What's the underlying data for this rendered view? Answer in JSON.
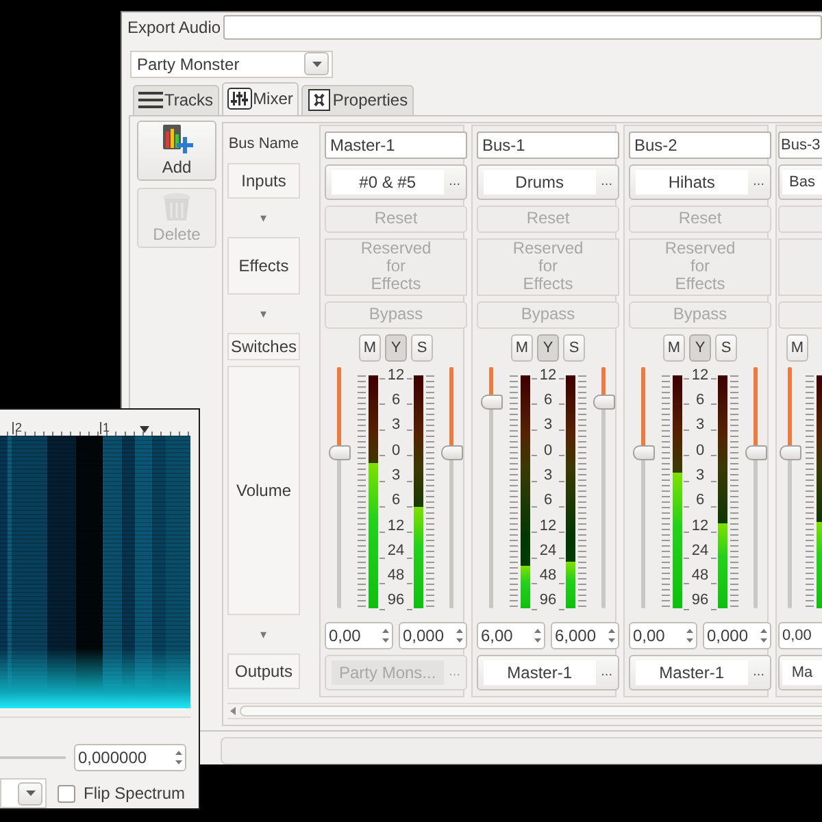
{
  "export_window": {
    "title_label": "Export Audio",
    "project_dropdown": "Party Monster",
    "tabs": [
      {
        "label": "Tracks",
        "selected": false
      },
      {
        "label": "Mixer",
        "selected": true
      },
      {
        "label": "Properties",
        "selected": false
      }
    ],
    "tools": [
      {
        "label": "Add",
        "disabled": false
      },
      {
        "label": "Delete",
        "disabled": true
      }
    ],
    "mixer": {
      "row_labels": [
        {
          "kind": "plain",
          "text": "Bus Name"
        },
        {
          "kind": "boxed",
          "text": "Inputs"
        },
        {
          "kind": "arrow",
          "text": "▾"
        },
        {
          "kind": "boxed",
          "text": "Effects"
        },
        {
          "kind": "arrow",
          "text": "▾"
        },
        {
          "kind": "boxed",
          "text": "Switches"
        },
        {
          "kind": "boxed",
          "text": "Volume"
        },
        {
          "kind": "arrow",
          "text": "▾"
        },
        {
          "kind": "boxed",
          "text": "Outputs"
        }
      ],
      "buses": [
        {
          "name": "Master-1",
          "input": {
            "value": "#0 & #5",
            "more": "..."
          },
          "reset": {
            "label": "Reset",
            "disabled": true
          },
          "effects": {
            "label": "Reserved for Effects",
            "disabled": true
          },
          "bypass": {
            "label": "Bypass",
            "disabled": true
          },
          "switches": [
            {
              "label": "M",
              "on": false
            },
            {
              "label": "Y",
              "on": true
            },
            {
              "label": "S",
              "on": false
            }
          ],
          "faders": [
            {
              "level": 0.65
            },
            {
              "level": 0.65
            }
          ],
          "meters": [
            {
              "level": 0.62
            },
            {
              "level": 0.43
            }
          ],
          "scale": [
            "12",
            "6",
            "3",
            "0",
            "3",
            "6",
            "12",
            "24",
            "48",
            "96"
          ],
          "spins": [
            "0,00",
            "0,000"
          ],
          "output": {
            "value": "Party Mons...",
            "more": "...",
            "disabled": true
          }
        },
        {
          "name": "Bus-1",
          "input": {
            "value": "Drums",
            "more": "..."
          },
          "reset": {
            "label": "Reset",
            "disabled": true
          },
          "effects": {
            "label": "Reserved for Effects",
            "disabled": true
          },
          "bypass": {
            "label": "Bypass",
            "disabled": true
          },
          "switches": [
            {
              "label": "M",
              "on": false
            },
            {
              "label": "Y",
              "on": true
            },
            {
              "label": "S",
              "on": false
            }
          ],
          "faders": [
            {
              "level": 0.87
            },
            {
              "level": 0.87
            }
          ],
          "meters": [
            {
              "level": 0.18
            },
            {
              "level": 0.2
            }
          ],
          "scale": [
            "12",
            "6",
            "3",
            "0",
            "3",
            "6",
            "12",
            "24",
            "48",
            "96"
          ],
          "spins": [
            "6,00",
            "6,000"
          ],
          "output": {
            "value": "Master-1",
            "more": "...",
            "disabled": false
          }
        },
        {
          "name": "Bus-2",
          "input": {
            "value": "Hihats",
            "more": "..."
          },
          "reset": {
            "label": "Reset",
            "disabled": true
          },
          "effects": {
            "label": "Reserved for Effects",
            "disabled": true
          },
          "bypass": {
            "label": "Bypass",
            "disabled": true
          },
          "switches": [
            {
              "label": "M",
              "on": false
            },
            {
              "label": "Y",
              "on": true
            },
            {
              "label": "S",
              "on": false
            }
          ],
          "faders": [
            {
              "level": 0.65
            },
            {
              "level": 0.65
            }
          ],
          "meters": [
            {
              "level": 0.58
            },
            {
              "level": 0.36
            }
          ],
          "scale": [
            "12",
            "6",
            "3",
            "0",
            "3",
            "6",
            "12",
            "24",
            "48",
            "96"
          ],
          "spins": [
            "0,00",
            "0,000"
          ],
          "output": {
            "value": "Master-1",
            "more": "...",
            "disabled": false
          }
        },
        {
          "name": "Bus-3",
          "input": {
            "value": "Bas"
          },
          "switches": [
            {
              "label": "M",
              "on": false
            }
          ],
          "faders": [
            {
              "level": 0.65
            }
          ],
          "meters": [
            {
              "level": 0.37
            }
          ],
          "spins": [
            "0,00"
          ],
          "output": {
            "value": "Ma",
            "disabled": false
          }
        }
      ]
    }
  },
  "spectrum_window": {
    "ruler_labels": [
      "2",
      "1"
    ],
    "offset_value": "0,000000",
    "flip_spectrum": {
      "label": "Flip Spectrum",
      "checked": false
    }
  }
}
